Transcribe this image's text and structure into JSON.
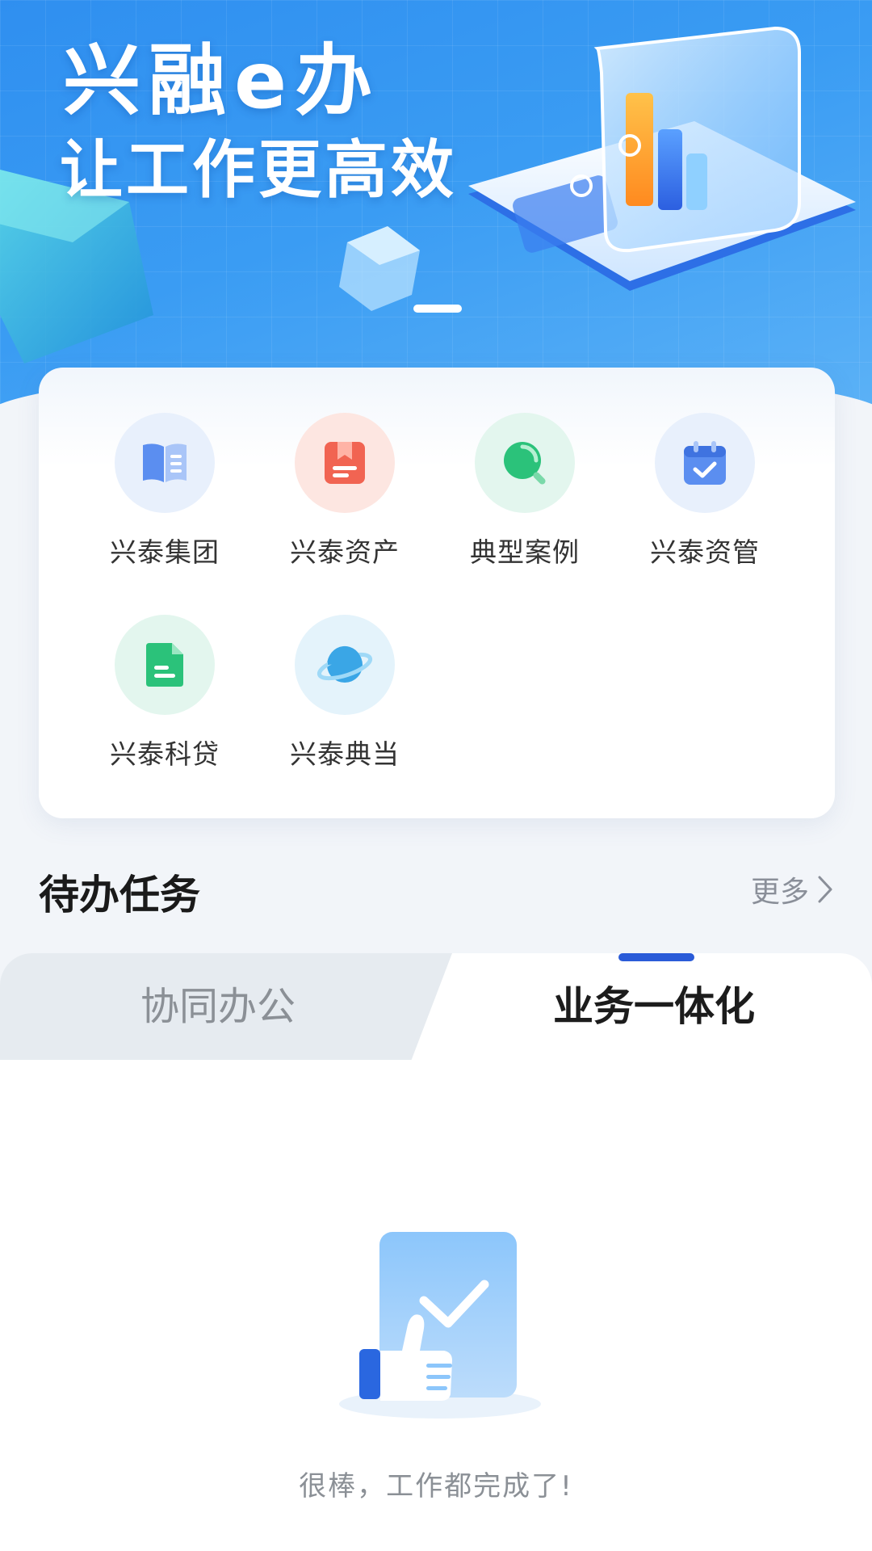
{
  "banner": {
    "title": "兴融e办",
    "subtitle": "让工作更高效"
  },
  "entries": [
    {
      "label": "兴泰集团",
      "icon": "book-icon",
      "bg": "#e8f0fc",
      "color": "#5b8ef0"
    },
    {
      "label": "兴泰资产",
      "icon": "bookmark-doc-icon",
      "bg": "#fde6e1",
      "color": "#f16452"
    },
    {
      "label": "典型案例",
      "icon": "magnifier-icon",
      "bg": "#e3f6ee",
      "color": "#2bc27a"
    },
    {
      "label": "兴泰资管",
      "icon": "calendar-check-icon",
      "bg": "#e8f0fc",
      "color": "#5b8ef0"
    },
    {
      "label": "兴泰科贷",
      "icon": "document-icon",
      "bg": "#e3f6ee",
      "color": "#2bc27a"
    },
    {
      "label": "兴泰典当",
      "icon": "planet-icon",
      "bg": "#e4f3fb",
      "color": "#3aa6e6"
    }
  ],
  "todo": {
    "title": "待办任务",
    "more_label": "更多"
  },
  "tabs": [
    {
      "label": "协同办公",
      "active": false
    },
    {
      "label": "业务一体化",
      "active": true
    }
  ],
  "empty_state": {
    "message": "很棒，工作都完成了!"
  }
}
